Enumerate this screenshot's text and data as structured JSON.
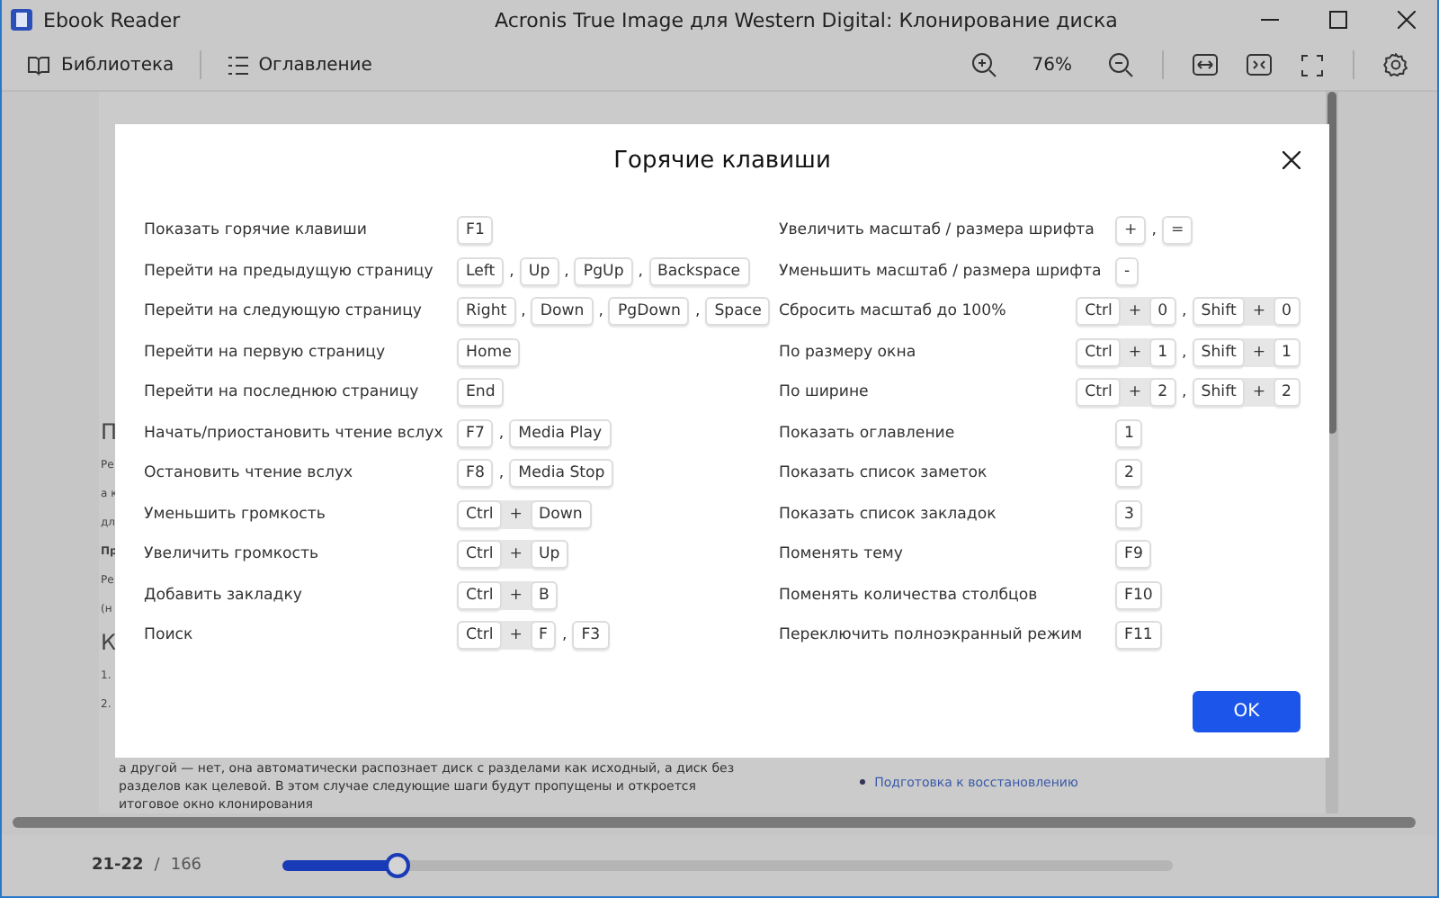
{
  "window": {
    "app_name": "Ebook Reader",
    "title": "Acronis True Image для Western Digital: Клонирование диска"
  },
  "toolbar": {
    "library": "Библиотека",
    "contents": "Оглавление",
    "zoom": "76%"
  },
  "page": {
    "fragments": [
      {
        "text": "П",
        "kind": "heading"
      },
      {
        "text": "Ре",
        "kind": "body"
      },
      {
        "text": "а к",
        "kind": "body"
      },
      {
        "text": "дл",
        "kind": "body"
      },
      {
        "text": "Пр",
        "kind": "bold"
      },
      {
        "text": "Ре",
        "kind": "body"
      },
      {
        "text": "(н",
        "kind": "body"
      },
      {
        "text": "К",
        "kind": "heading"
      },
      {
        "text": "1.",
        "kind": "body"
      },
      {
        "text": "2.",
        "kind": "body"
      }
    ],
    "paragraph_lines": [
      "а другой — нет, она автоматически распознает диск с разделами как исходный, а диск без",
      "разделов как целевой. В этом случае следующие шаги будут пропущены и откроется",
      "итоговое окно клонирования"
    ],
    "link": "Подготовка к восстановлению"
  },
  "dialog": {
    "title": "Горячие клавиши",
    "separator": ",",
    "joiner": "+",
    "ok": "OK",
    "left": [
      {
        "action": "Показать горячие клавиши",
        "shortcuts": [
          [
            "F1"
          ]
        ]
      },
      {
        "action": "Перейти на предыдущую страницу",
        "shortcuts": [
          [
            "Left"
          ],
          [
            "Up"
          ],
          [
            "PgUp"
          ],
          [
            "Backspace"
          ]
        ]
      },
      {
        "action": "Перейти на следующую страницу",
        "shortcuts": [
          [
            "Right"
          ],
          [
            "Down"
          ],
          [
            "PgDown"
          ],
          [
            "Space"
          ]
        ]
      },
      {
        "action": "Перейти на первую страницу",
        "shortcuts": [
          [
            "Home"
          ]
        ]
      },
      {
        "action": "Перейти на последнюю страницу",
        "shortcuts": [
          [
            "End"
          ]
        ]
      },
      {
        "action": "Начать/приостановить чтение вслух",
        "shortcuts": [
          [
            "F7"
          ],
          [
            "Media Play"
          ]
        ]
      },
      {
        "action": "Остановить чтение вслух",
        "shortcuts": [
          [
            "F8"
          ],
          [
            "Media Stop"
          ]
        ]
      },
      {
        "action": "Уменьшить громкость",
        "shortcuts": [
          [
            "Ctrl",
            "Down"
          ]
        ]
      },
      {
        "action": "Увеличить громкость",
        "shortcuts": [
          [
            "Ctrl",
            "Up"
          ]
        ]
      },
      {
        "action": "Добавить закладку",
        "shortcuts": [
          [
            "Ctrl",
            "B"
          ]
        ]
      },
      {
        "action": "Поиск",
        "shortcuts": [
          [
            "Ctrl",
            "F"
          ],
          [
            "F3"
          ]
        ]
      }
    ],
    "right": [
      {
        "action": "Увеличить масштаб / размера шрифта",
        "shortcuts": [
          [
            "+"
          ],
          [
            "="
          ]
        ]
      },
      {
        "action": "Уменьшить масштаб / размера шрифта",
        "shortcuts": [
          [
            "-"
          ]
        ]
      },
      {
        "action": "Сбросить масштаб до 100%",
        "shortcuts": [
          [
            "Ctrl",
            "0"
          ],
          [
            "Shift",
            "0"
          ]
        ]
      },
      {
        "action": "По размеру окна",
        "shortcuts": [
          [
            "Ctrl",
            "1"
          ],
          [
            "Shift",
            "1"
          ]
        ]
      },
      {
        "action": "По ширине",
        "shortcuts": [
          [
            "Ctrl",
            "2"
          ],
          [
            "Shift",
            "2"
          ]
        ]
      },
      {
        "action": "Показать оглавление",
        "shortcuts": [
          [
            "1"
          ]
        ]
      },
      {
        "action": "Показать список заметок",
        "shortcuts": [
          [
            "2"
          ]
        ]
      },
      {
        "action": "Показать список закладок",
        "shortcuts": [
          [
            "3"
          ]
        ]
      },
      {
        "action": "Поменять тему",
        "shortcuts": [
          [
            "F9"
          ]
        ]
      },
      {
        "action": "Поменять количества столбцов",
        "shortcuts": [
          [
            "F10"
          ]
        ]
      },
      {
        "action": "Переключить полноэкранный режим",
        "shortcuts": [
          [
            "F11"
          ]
        ]
      }
    ]
  },
  "footer": {
    "current_pages": "21-22",
    "divider": "/",
    "total_pages": "166",
    "progress": {
      "level": 0.125
    }
  }
}
